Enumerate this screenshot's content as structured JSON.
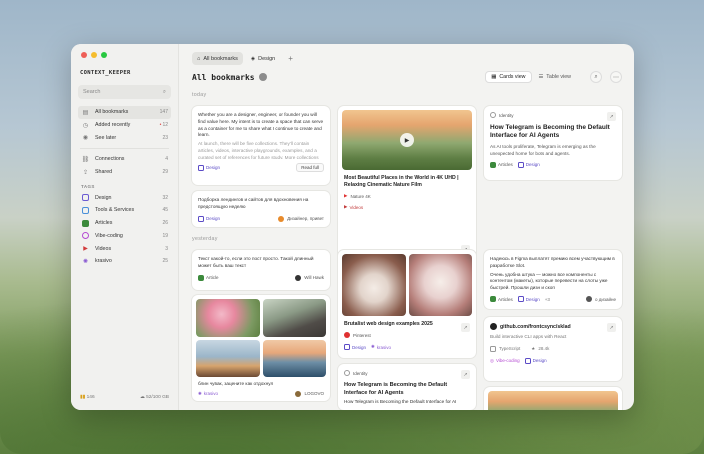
{
  "app": {
    "name": "CONTEXT_KEEPER"
  },
  "sidebar": {
    "search_placeholder": "Search",
    "items": [
      {
        "label": "All bookmarks",
        "count": "147",
        "icon": "bookmarks-icon"
      },
      {
        "label": "Added recently",
        "count": "12",
        "icon": "clock-icon",
        "dot": "•"
      },
      {
        "label": "See later",
        "count": "23",
        "icon": "eye-icon"
      },
      {
        "label": "Connections",
        "count": "4",
        "icon": "link-icon"
      },
      {
        "label": "Shared",
        "count": "29",
        "icon": "share-icon"
      }
    ],
    "tags_label": "TAGS",
    "tags": [
      {
        "label": "Design",
        "count": "32",
        "color": "#6b5bd2",
        "icon": "design-icon"
      },
      {
        "label": "Tools & Services",
        "count": "45",
        "color": "#4a90d9",
        "icon": "tools-icon"
      },
      {
        "label": "Articles",
        "count": "26",
        "color": "#3c8a3c",
        "icon": "articles-icon"
      },
      {
        "label": "Vibe-coding",
        "count": "19",
        "color": "#b44bd2",
        "icon": "vibe-icon"
      },
      {
        "label": "Videos",
        "count": "3",
        "color": "#d23b3b",
        "icon": "play-icon"
      },
      {
        "label": "krasivo",
        "count": "25",
        "color": "#8a5bd2",
        "icon": "sparkle-icon"
      }
    ],
    "footer": {
      "left": "146",
      "right": "52/100 GB"
    }
  },
  "tabs": [
    {
      "label": "All bookmarks"
    },
    {
      "label": "Design"
    }
  ],
  "header": {
    "title": "All bookmarks",
    "count_badge": "",
    "cards_view": "Cards view",
    "table_view": "Table view"
  },
  "groups": {
    "today": "today",
    "yesterday": "yesterday"
  },
  "cards": {
    "c1": {
      "text": "Whether you are a designer, engineer, or founder you will find value here. My intent is to create a space that can serve as a container for me to share what I continue to create and learn.",
      "text2": "At launch, there will be five collections. They'll contain articles, videos, interactive playgrounds, examples, and a curated set of references for future study. More collections will open...",
      "tag": "Design",
      "button": "Read full"
    },
    "c2": {
      "text": "Подборка лендингов и сайтов для вдохновения на предстоящую неделю",
      "tag": "Design",
      "source": "Дизайнер, привет"
    },
    "c3": {
      "title": "Most Beautiful Places in the World in 4K UHD | Relaxing Cinematic Nature Film",
      "source": "Nature 4K",
      "tag": "Videos"
    },
    "c4": {
      "source": "Identity",
      "title": "How Telegram is Becoming the Default Interface for AI Agents",
      "text": "As AI tools proliferate, Telegram is emerging as the unexpected home for bots and agents.",
      "tag1": "Articles",
      "tag2": "Design"
    },
    "c5": {
      "text": "Текст какой-то, если это пост просто. Такой длинный может быть ваш текст",
      "tag": "Article",
      "source": "Will Hawk"
    },
    "c6": {
      "caption": "блин чувак, зацените как отдохнул",
      "tag": "krasivo",
      "source": "LOGOVO"
    },
    "c7": {
      "title": "Brutalist web design examples 2025",
      "source": "Pinterest",
      "tag1": "Design",
      "tag2": "krasivo"
    },
    "c8": {
      "source": "Identity",
      "title": "How Telegram is Becoming the Default Interface for AI Agents",
      "text": "How Telegram is Becoming the Default Interface for AI"
    },
    "c9": {
      "text": "Надеюсь в Figma выплатят премию всем участвующим в разработке Slot.",
      "text2": "Очень удобна штука — можно все компоненты с контентом (макеты), которые перевести на слоты уже быстрей. Прошли дизн и скоп",
      "tag1": "Articles",
      "tag2": "Design",
      "extra": "+3",
      "source": "о дизайне"
    },
    "c10": {
      "title": "github.com/frontcsync/sklad",
      "text": "Build interactive CLI apps with React",
      "lang": "TypeScript",
      "stars": "28.4k",
      "tag1": "Vibe-coding",
      "tag2": "Design"
    }
  }
}
